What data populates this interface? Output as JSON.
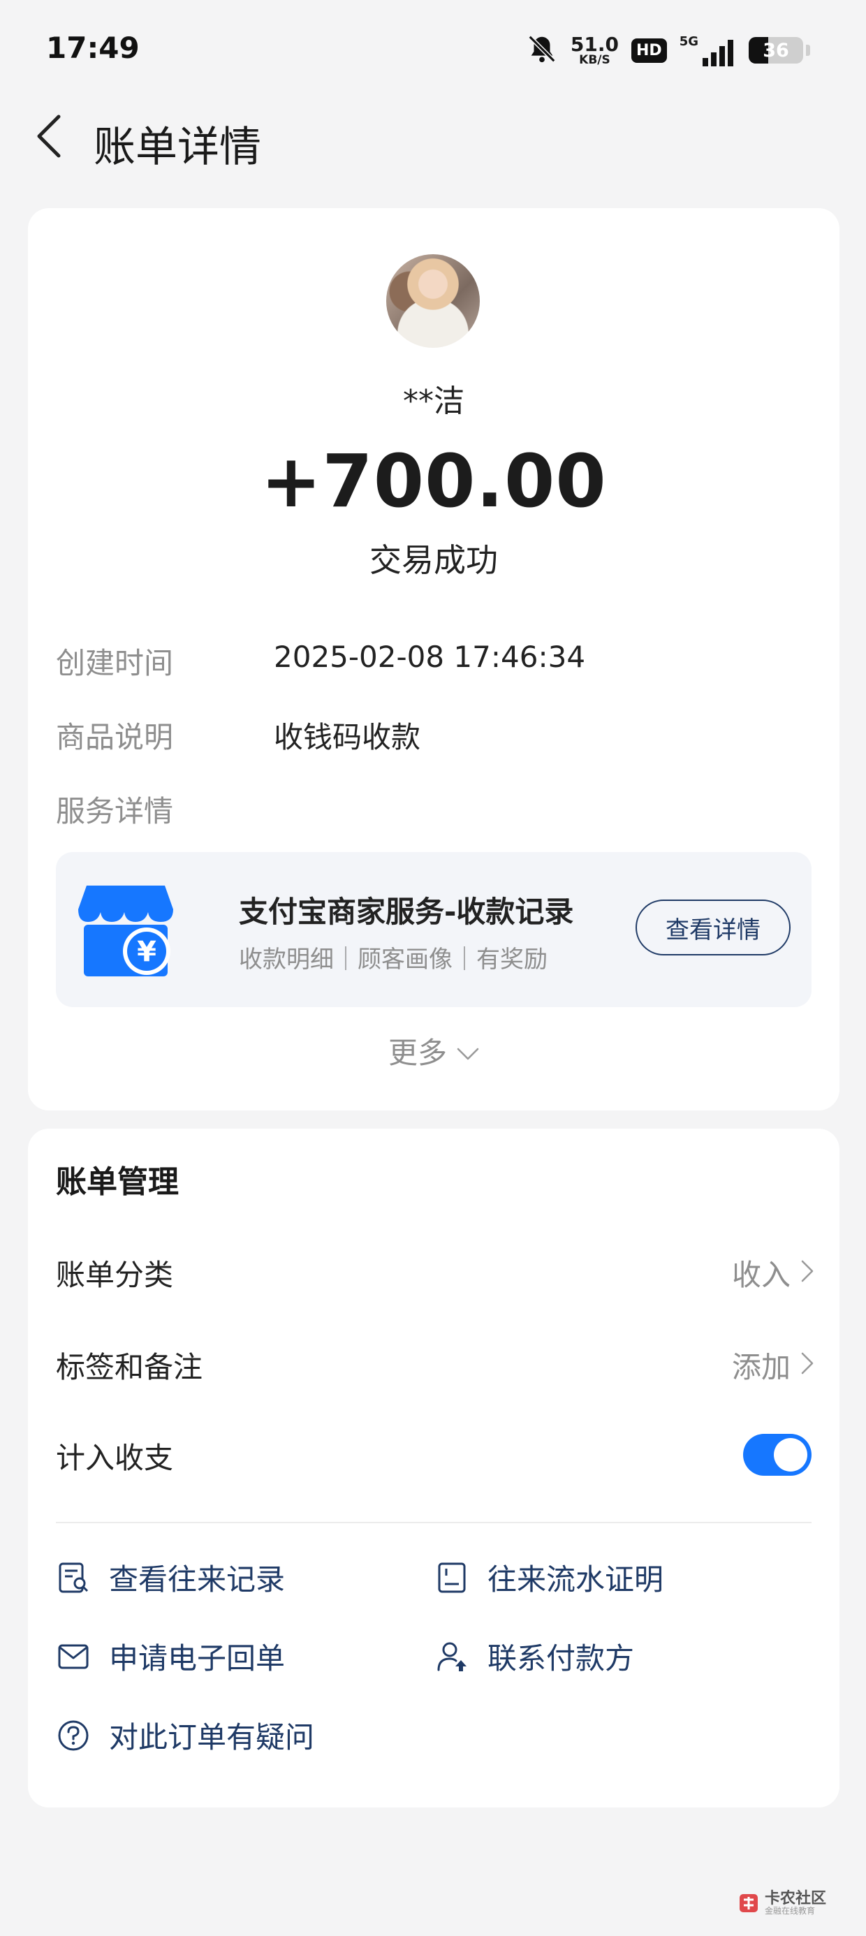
{
  "status_bar": {
    "time": "17:49",
    "net_speed_value": "51.0",
    "net_speed_unit": "KB/S",
    "hd_label": "HD",
    "network_label": "5G",
    "battery_level": "36"
  },
  "header": {
    "title": "账单详情"
  },
  "transaction": {
    "payer_name": "**洁",
    "amount": "+700.00",
    "status": "交易成功",
    "created_time_label": "创建时间",
    "created_time_value": "2025-02-08 17:46:34",
    "product_label": "商品说明",
    "product_value": "收钱码收款",
    "service_label": "服务详情"
  },
  "service_card": {
    "title": "支付宝商家服务-收款记录",
    "subtitle": "收款明细｜顾客画像｜有奖励",
    "button_label": "查看详情",
    "icon_symbol": "¥",
    "brand_color": "#1677ff"
  },
  "more": {
    "label": "更多"
  },
  "bill_management": {
    "title": "账单管理",
    "category_label": "账单分类",
    "category_value": "收入",
    "tags_label": "标签和备注",
    "tags_value": "添加",
    "include_label": "计入收支",
    "include_enabled": true
  },
  "actions": {
    "view_history": "查看往来记录",
    "statement_proof": "往来流水证明",
    "e_receipt": "申请电子回单",
    "contact_payer": "联系付款方",
    "order_question": "对此订单有疑问"
  },
  "watermark": {
    "main": "卡农社区",
    "sub": "金融在线教育"
  },
  "colors": {
    "accent_blue": "#1677ff",
    "link_navy": "#1f3a66",
    "muted_gray": "#8e8e8e"
  }
}
